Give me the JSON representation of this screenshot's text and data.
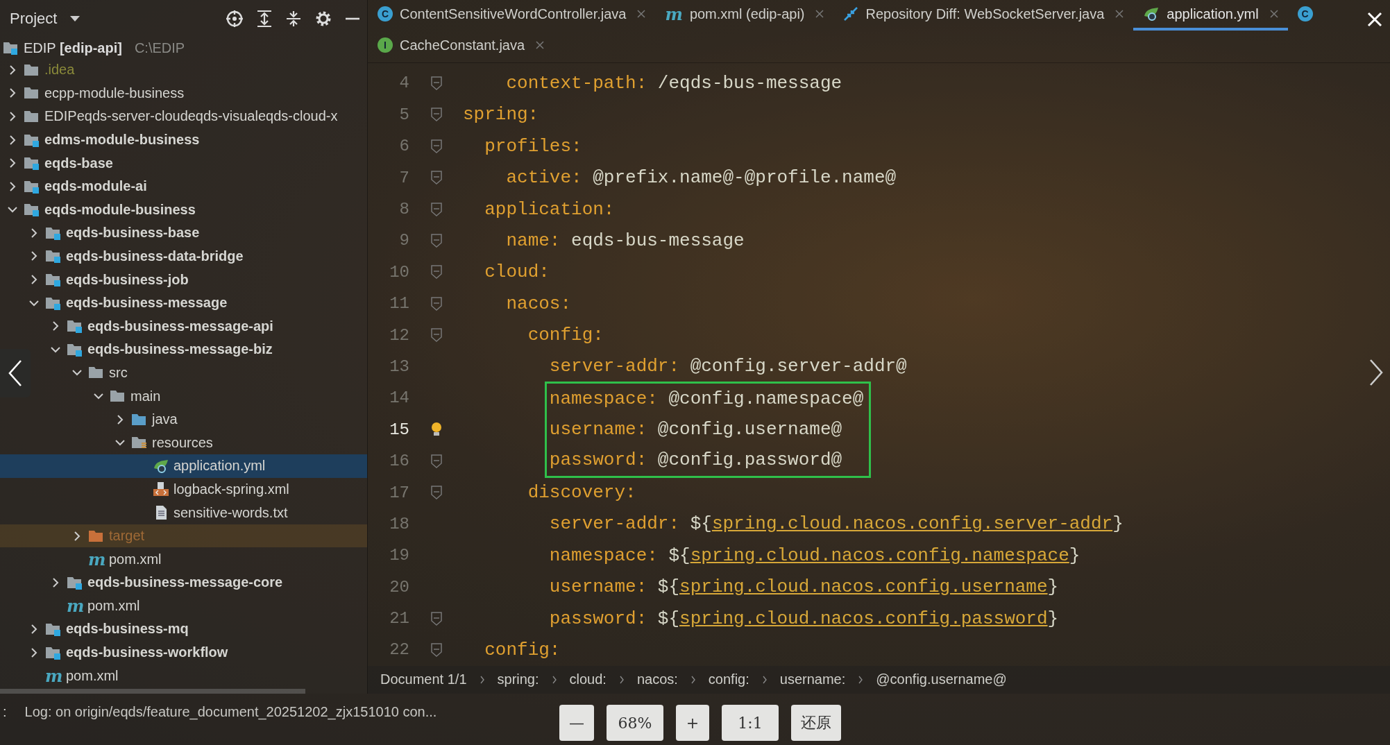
{
  "project_panel": {
    "title": "Project",
    "root": {
      "name": "EDIP",
      "module": "[edip-api]",
      "path": "C:\\EDIP"
    },
    "tree": [
      {
        "name": ".idea",
        "kind": "idea",
        "expanded": false
      },
      {
        "name": "ecpp-module-business",
        "kind": "folder",
        "expanded": false
      },
      {
        "name": "EDIPeqds-server-cloudeqds-visualeqds-cloud-x",
        "kind": "folder",
        "expanded": false
      },
      {
        "name": "edms-module-business",
        "kind": "module",
        "expanded": false
      },
      {
        "name": "eqds-base",
        "kind": "module",
        "expanded": false
      },
      {
        "name": "eqds-module-ai",
        "kind": "module",
        "expanded": false
      },
      {
        "name": "eqds-module-business",
        "kind": "module",
        "expanded": true,
        "children": [
          {
            "name": "eqds-business-base",
            "kind": "module",
            "expanded": false
          },
          {
            "name": "eqds-business-data-bridge",
            "kind": "module",
            "expanded": false
          },
          {
            "name": "eqds-business-job",
            "kind": "module",
            "expanded": false
          },
          {
            "name": "eqds-business-message",
            "kind": "module",
            "expanded": true,
            "children": [
              {
                "name": "eqds-business-message-api",
                "kind": "module",
                "expanded": false
              },
              {
                "name": "eqds-business-message-biz",
                "kind": "module",
                "expanded": true,
                "children": [
                  {
                    "name": "src",
                    "kind": "folder",
                    "expanded": true,
                    "children": [
                      {
                        "name": "main",
                        "kind": "folder",
                        "expanded": true,
                        "children": [
                          {
                            "name": "java",
                            "kind": "source",
                            "expanded": false
                          },
                          {
                            "name": "resources",
                            "kind": "resources",
                            "expanded": true,
                            "children": [
                              {
                                "name": "application.yml",
                                "kind": "yml",
                                "selected": true
                              },
                              {
                                "name": "logback-spring.xml",
                                "kind": "xml",
                                "selected": false
                              },
                              {
                                "name": "sensitive-words.txt",
                                "kind": "txt",
                                "selected": false
                              }
                            ]
                          }
                        ]
                      }
                    ]
                  },
                  {
                    "name": "target",
                    "kind": "excluded",
                    "expanded": false
                  },
                  {
                    "name": "pom.xml",
                    "kind": "maven",
                    "glyph": "m",
                    "selected": false
                  }
                ]
              },
              {
                "name": "eqds-business-message-core",
                "kind": "module",
                "expanded": false
              },
              {
                "name": "pom.xml",
                "kind": "maven",
                "glyph": "m",
                "selected": false
              }
            ]
          },
          {
            "name": "eqds-business-mq",
            "kind": "module",
            "expanded": false
          },
          {
            "name": "eqds-business-workflow",
            "kind": "module",
            "expanded": false
          },
          {
            "name": "pom.xml",
            "kind": "maven",
            "glyph": "m",
            "selected": false
          }
        ]
      }
    ]
  },
  "editor_tabs": [
    [
      {
        "label": "ContentSensitiveWordController.java",
        "kind": "class",
        "glyph": "C",
        "selected": false
      },
      {
        "label": "pom.xml (edip-api)",
        "kind": "maven",
        "glyph": "m",
        "selected": false
      },
      {
        "label": "Repository Diff: WebSocketServer.java",
        "kind": "diff",
        "selected": false
      },
      {
        "label": "application.yml",
        "kind": "yml",
        "selected": true
      },
      {
        "kind": "class",
        "glyph": "C",
        "selected": false
      }
    ],
    [
      {
        "label": "CacheConstant.java",
        "kind": "interface",
        "glyph": "I",
        "selected": false
      }
    ]
  ],
  "code_lines": [
    {
      "number": "4",
      "key": "    context-path:",
      "value": [
        {
          "text": "/eqds-bus-message",
          "kind": "plain"
        }
      ],
      "fold": true,
      "current": false,
      "boxed": false
    },
    {
      "number": "5",
      "key": "spring:",
      "fold": true,
      "current": false,
      "boxed": false
    },
    {
      "number": "6",
      "key": "  profiles:",
      "fold": true,
      "current": false,
      "boxed": false
    },
    {
      "number": "7",
      "key": "    active:",
      "value": [
        {
          "text": "@prefix.name@-@profile.name@",
          "kind": "plain"
        }
      ],
      "fold": true,
      "current": false,
      "boxed": false
    },
    {
      "number": "8",
      "key": "  application:",
      "fold": true,
      "current": false,
      "boxed": false
    },
    {
      "number": "9",
      "key": "    name:",
      "value": [
        {
          "text": "eqds-bus-message",
          "kind": "plain"
        }
      ],
      "fold": true,
      "current": false,
      "boxed": false
    },
    {
      "number": "10",
      "key": "  cloud:",
      "fold": true,
      "current": false,
      "boxed": false
    },
    {
      "number": "11",
      "key": "    nacos:",
      "fold": true,
      "current": false,
      "boxed": false
    },
    {
      "number": "12",
      "key": "      config:",
      "fold": true,
      "current": false,
      "boxed": false
    },
    {
      "number": "13",
      "key": "        server-addr:",
      "value": [
        {
          "text": "@config.server-addr@",
          "kind": "plain"
        }
      ],
      "fold": false,
      "current": false,
      "boxed": false
    },
    {
      "number": "14",
      "key": "        namespace:",
      "value": [
        {
          "text": "@config.namespace@",
          "kind": "plain"
        }
      ],
      "fold": false,
      "current": false,
      "boxed": true
    },
    {
      "number": "15",
      "key": "        username:",
      "value": [
        {
          "text": "@config.username@",
          "kind": "plain"
        }
      ],
      "fold": false,
      "current": true,
      "boxed": true
    },
    {
      "number": "16",
      "key": "        password:",
      "value": [
        {
          "text": "@config.password@",
          "kind": "plain"
        }
      ],
      "fold": true,
      "current": false,
      "boxed": true
    },
    {
      "number": "17",
      "key": "      discovery:",
      "fold": true,
      "current": false,
      "boxed": false
    },
    {
      "number": "18",
      "key": "        server-addr:",
      "value": [
        {
          "text": "${",
          "kind": "plain"
        },
        {
          "text": "spring.cloud.nacos.config.server-addr",
          "kind": "link"
        },
        {
          "text": "}",
          "kind": "plain"
        }
      ],
      "fold": false,
      "current": false,
      "boxed": false
    },
    {
      "number": "19",
      "key": "        namespace:",
      "value": [
        {
          "text": "${",
          "kind": "plain"
        },
        {
          "text": "spring.cloud.nacos.config.namespace",
          "kind": "link"
        },
        {
          "text": "}",
          "kind": "plain"
        }
      ],
      "fold": false,
      "current": false,
      "boxed": false
    },
    {
      "number": "20",
      "key": "        username:",
      "value": [
        {
          "text": "${",
          "kind": "plain"
        },
        {
          "text": "spring.cloud.nacos.config.username",
          "kind": "link"
        },
        {
          "text": "}",
          "kind": "plain"
        }
      ],
      "fold": false,
      "current": false,
      "boxed": false
    },
    {
      "number": "21",
      "key": "        password:",
      "value": [
        {
          "text": "${",
          "kind": "plain"
        },
        {
          "text": "spring.cloud.nacos.config.password",
          "kind": "link"
        },
        {
          "text": "}",
          "kind": "plain"
        }
      ],
      "fold": true,
      "current": false,
      "boxed": false
    },
    {
      "number": "22",
      "key": "  config:",
      "fold": true,
      "current": false,
      "boxed": false
    }
  ],
  "breadcrumb": [
    "Document 1/1",
    "spring:",
    "cloud:",
    "nacos:",
    "config:",
    "username:",
    "@config.username@"
  ],
  "log_bar": {
    "prefix": ":",
    "text": "Log: on origin/eqds/feature_document_20251202_zjx151010 con..."
  },
  "viewer_toolbar": [
    "—",
    "68%",
    "+",
    "1:1",
    "还原"
  ]
}
